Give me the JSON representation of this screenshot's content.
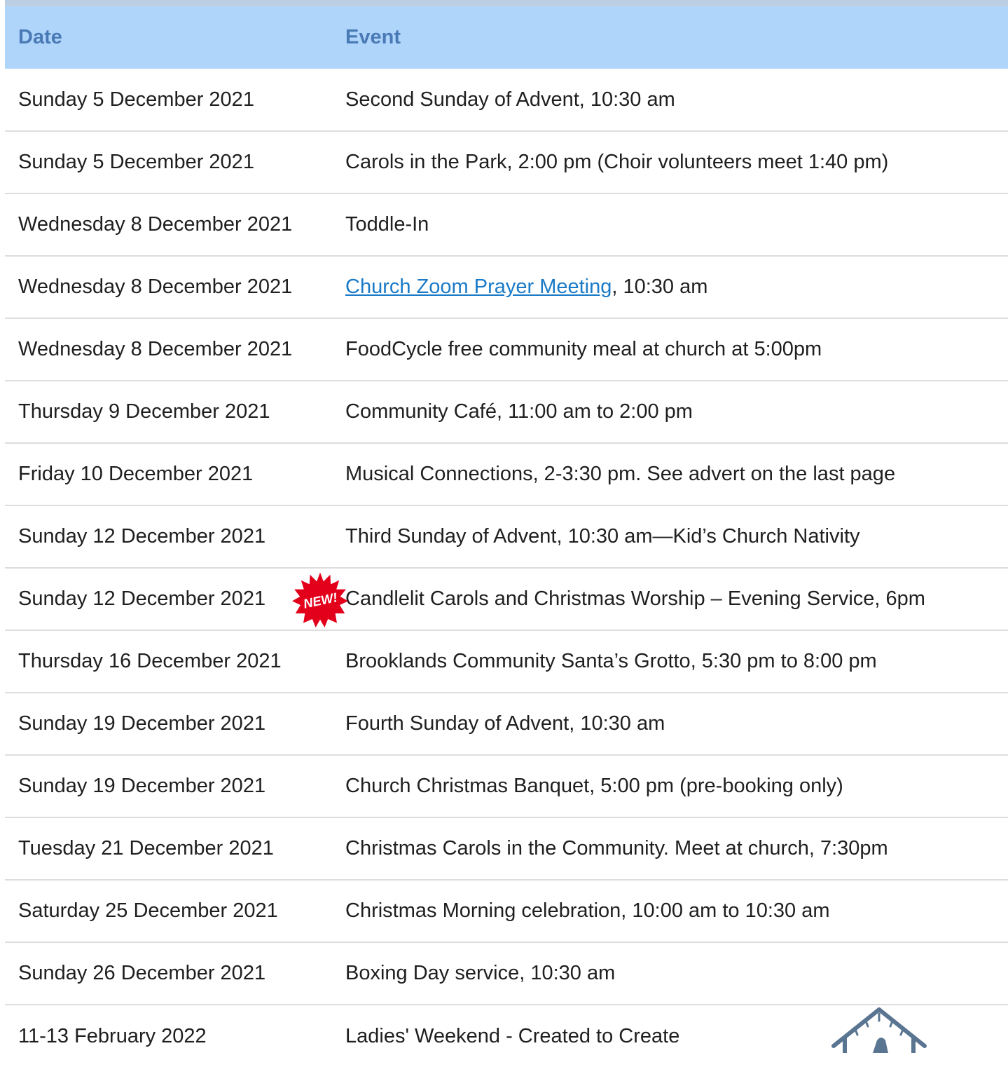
{
  "table": {
    "headers": {
      "date": "Date",
      "event": "Event"
    },
    "rows": [
      {
        "date": "Sunday 5 December 2021",
        "event": "Second Sunday of Advent, 10:30 am"
      },
      {
        "date": "Sunday 5 December 2021",
        "event": "Carols in the Park, 2:00 pm (Choir volunteers meet 1:40 pm)"
      },
      {
        "date": "Wednesday 8 December 2021",
        "event": "Toddle-In"
      },
      {
        "date": "Wednesday 8 December 2021",
        "event_link": "Church Zoom Prayer Meeting",
        "event_suffix": ", 10:30 am"
      },
      {
        "date": "Wednesday 8 December 2021",
        "event": "FoodCycle free community meal at church at 5:00pm"
      },
      {
        "date": "Thursday 9 December 2021",
        "event": "Community Café, 11:00 am to 2:00 pm"
      },
      {
        "date": "Friday 10 December 2021",
        "event": "Musical Connections, 2-3:30 pm. See advert on the last page"
      },
      {
        "date": "Sunday 12 December 2021",
        "event": "Third Sunday of Advent, 10:30 am—Kid’s Church Nativity"
      },
      {
        "date": "Sunday 12 December 2021",
        "badge": "NEW!",
        "event": "Candlelit Carols and Christmas Worship – Evening Service, 6pm"
      },
      {
        "date": "Thursday 16 December 2021",
        "event": "Brooklands Community Santa’s Grotto, 5:30 pm to 8:00 pm"
      },
      {
        "date": "Sunday 19 December 2021",
        "event": "Fourth Sunday of Advent, 10:30 am"
      },
      {
        "date": "Sunday 19 December 2021",
        "event": "Church Christmas Banquet, 5:00 pm (pre-booking only)"
      },
      {
        "date": "Tuesday 21 December 2021",
        "event": "Christmas Carols in the Community. Meet at church, 7:30pm"
      },
      {
        "date": "Saturday 25 December 2021",
        "event": "Christmas Morning celebration, 10:00 am to 10:30 am"
      },
      {
        "date": "Sunday 26 December 2021",
        "event": "Boxing Day service, 10:30 am"
      },
      {
        "date": "11-13 February 2022",
        "event": "Ladies' Weekend - Created to Create"
      }
    ]
  },
  "colors": {
    "header_bg": "#b0d5fb",
    "header_text": "#4a7ab5",
    "link": "#1a7ac7",
    "badge": "#e3001b",
    "icon": "#5a7591"
  },
  "icons": {
    "badge": "new-starburst-icon",
    "decoration": "nativity-stable-icon"
  }
}
